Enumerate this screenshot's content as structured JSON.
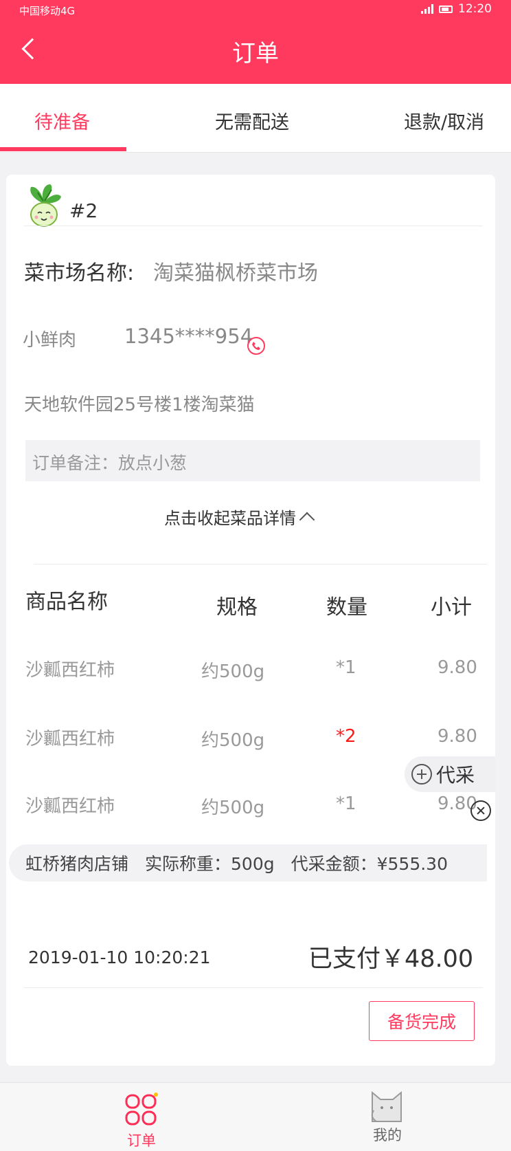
{
  "status_bar": {
    "carrier": "中国移动4G",
    "time": "12:20"
  },
  "header": {
    "title": "订单"
  },
  "tabs": [
    {
      "label": "待准备",
      "active": true
    },
    {
      "label": "无需配送",
      "active": false
    },
    {
      "label": "退款/取消",
      "active": false
    }
  ],
  "order": {
    "number": "#2",
    "market_label": "菜市场名称:",
    "market_value": "淘菜猫枫桥菜市场",
    "customer_name": "小鲜肉",
    "customer_phone": "1345****954",
    "address": "天地软件园25号楼1楼淘菜猫",
    "note": "订单备注：放点小葱",
    "toggle_label": "点击收起菜品详情",
    "table_headers": [
      "商品名称",
      "规格",
      "数量",
      "小计"
    ],
    "items": [
      {
        "name": "沙瓤西红柿",
        "spec": "约500g",
        "qty": "*1",
        "subtotal": "9.80",
        "qty_highlight": false
      },
      {
        "name": "沙瓤西红柿",
        "spec": "约500g",
        "qty": "*2",
        "subtotal": "9.80",
        "qty_highlight": true
      },
      {
        "name": "沙瓤西红柿",
        "spec": "约500g",
        "qty": "*1",
        "subtotal": "9.80",
        "qty_highlight": false
      }
    ],
    "proxy_button_label": "代采",
    "proxy_info": {
      "shop": "虹桥猪肉店铺",
      "weight": "实际称重：500g",
      "amount": "代采金额：¥555.30"
    },
    "datetime": "2019-01-10  10:20:21",
    "paid": "已支付￥48.00",
    "done_button": "备货完成"
  },
  "bottom_nav": [
    {
      "label": "订单",
      "icon": "order-icon",
      "active": true
    },
    {
      "label": "我的",
      "icon": "cat-profile-icon",
      "active": false
    }
  ],
  "colors": {
    "brand": "#ff3a5e",
    "highlight_qty": "#ff1a1a"
  }
}
